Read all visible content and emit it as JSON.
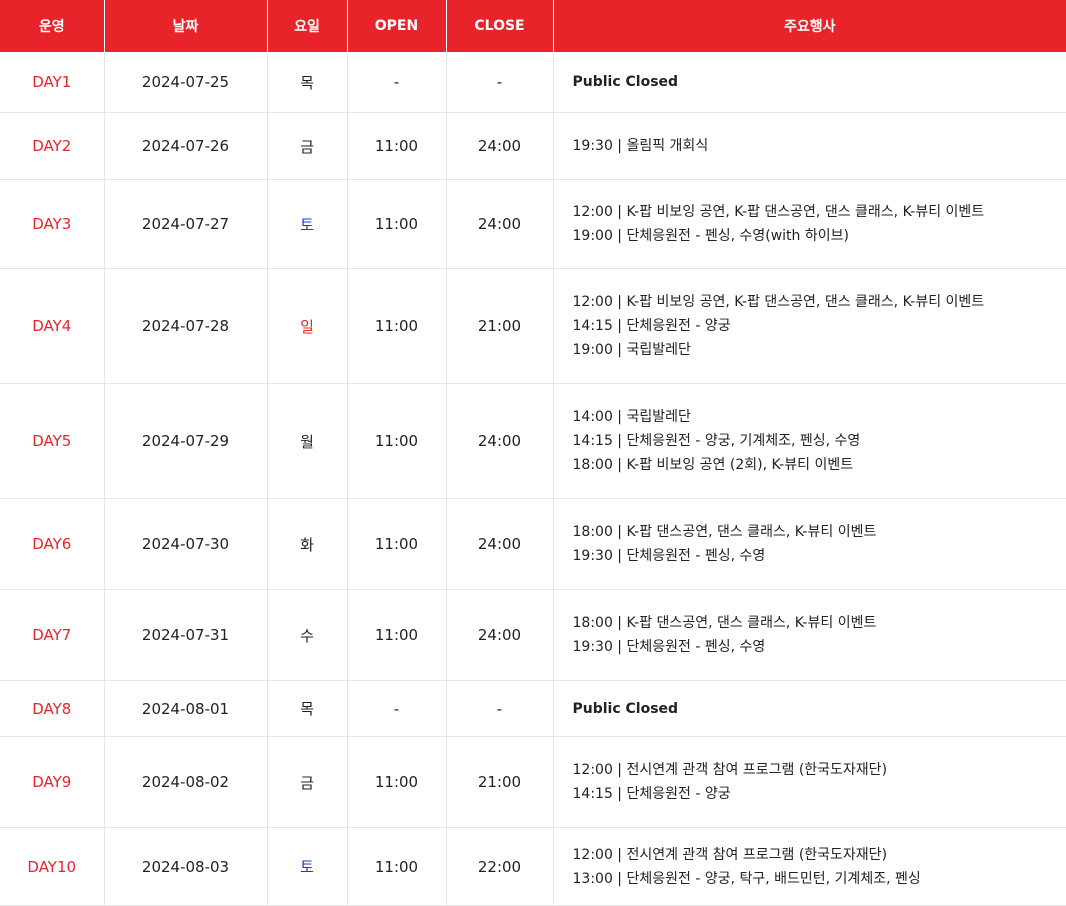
{
  "headers": {
    "day": "운영",
    "date": "날짜",
    "dow": "요일",
    "open": "OPEN",
    "close": "CLOSE",
    "events": "주요행사"
  },
  "colors": {
    "accent": "#e8242a",
    "saturday": "#1a3fc9",
    "sunday": "#e8242a"
  },
  "rows": [
    {
      "day": "DAY1",
      "date": "2024-07-25",
      "dow": "목",
      "open": "-",
      "close": "-",
      "events": [
        "Public Closed"
      ]
    },
    {
      "day": "DAY2",
      "date": "2024-07-26",
      "dow": "금",
      "open": "11:00",
      "close": "24:00",
      "events": [
        "19:30 | 올림픽 개회식"
      ]
    },
    {
      "day": "DAY3",
      "date": "2024-07-27",
      "dow": "토",
      "open": "11:00",
      "close": "24:00",
      "events": [
        "12:00 | K-팝 비보잉 공연, K-팝 댄스공연, 댄스 클래스, K-뷰티 이벤트",
        "19:00 | 단체응원전 - 펜싱, 수영(with 하이브)"
      ]
    },
    {
      "day": "DAY4",
      "date": "2024-07-28",
      "dow": "일",
      "open": "11:00",
      "close": "21:00",
      "events": [
        "12:00 | K-팝 비보잉 공연, K-팝 댄스공연, 댄스 클래스, K-뷰티 이벤트",
        "14:15 | 단체응원전 - 양궁",
        "19:00 | 국립발레단"
      ]
    },
    {
      "day": "DAY5",
      "date": "2024-07-29",
      "dow": "월",
      "open": "11:00",
      "close": "24:00",
      "events": [
        "14:00 | 국립발레단",
        "14:15 | 단체응원전 - 양궁, 기계체조, 펜싱, 수영",
        "18:00 | K-팝 비보잉 공연 (2회), K-뷰티 이벤트"
      ]
    },
    {
      "day": "DAY6",
      "date": "2024-07-30",
      "dow": "화",
      "open": "11:00",
      "close": "24:00",
      "events": [
        "18:00 | K-팝 댄스공연, 댄스 클래스, K-뷰티 이벤트",
        "19:30 | 단체응원전 - 펜싱, 수영"
      ]
    },
    {
      "day": "DAY7",
      "date": "2024-07-31",
      "dow": "수",
      "open": "11:00",
      "close": "24:00",
      "events": [
        "18:00 | K-팝 댄스공연, 댄스 클래스, K-뷰티 이벤트",
        "19:30 | 단체응원전 - 펜싱, 수영"
      ]
    },
    {
      "day": "DAY8",
      "date": "2024-08-01",
      "dow": "목",
      "open": "-",
      "close": "-",
      "events": [
        "Public Closed"
      ]
    },
    {
      "day": "DAY9",
      "date": "2024-08-02",
      "dow": "금",
      "open": "11:00",
      "close": "21:00",
      "events": [
        "12:00 | 전시연계 관객 참여 프로그램 (한국도자재단)",
        "14:15 | 단체응원전 - 양궁"
      ]
    },
    {
      "day": "DAY10",
      "date": "2024-08-03",
      "dow": "토",
      "open": "11:00",
      "close": "22:00",
      "events": [
        "12:00 | 전시연계 관객 참여 프로그램 (한국도자재단)",
        "13:00 | 단체응원전 - 양궁, 탁구, 배드민턴, 기계체조, 펜싱"
      ]
    }
  ]
}
